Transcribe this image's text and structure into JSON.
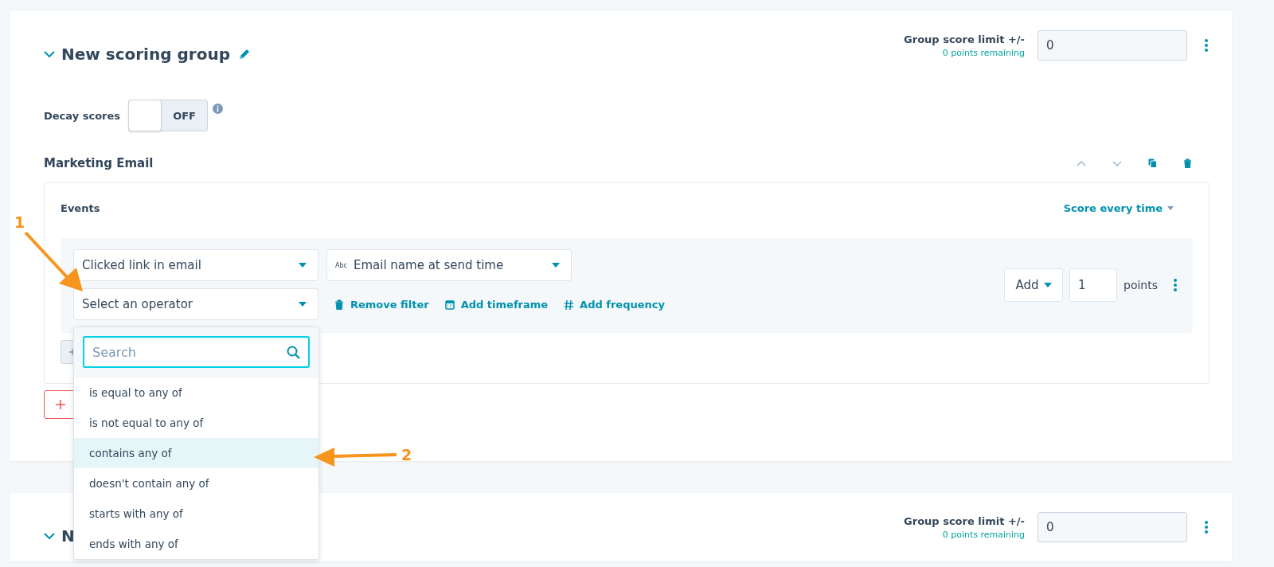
{
  "groups": [
    {
      "title": "New scoring group",
      "expanded": true,
      "score_limit_label": "Group score limit +/-",
      "remaining": "0 points remaining",
      "score_limit": "0",
      "decay": {
        "label": "Decay scores",
        "on": false,
        "state_text": "OFF"
      },
      "sections": [
        {
          "title": "Marketing Email",
          "events_label": "Events",
          "frequency": "Score every time",
          "filters": [
            {
              "event": "Clicked link in email",
              "property_badge": "Abc",
              "property": "Email name at send time",
              "operator_placeholder": "Select an operator",
              "actions": [
                {
                  "kind": "trash",
                  "label": "Remove filter"
                },
                {
                  "kind": "calendar",
                  "label": "Add timeframe"
                },
                {
                  "kind": "hash",
                  "label": "Add frequency"
                }
              ],
              "mode": "Add",
              "points": "1",
              "points_label": "points"
            }
          ]
        }
      ]
    },
    {
      "title": "N",
      "expanded": true,
      "score_limit_label": "Group score limit +/-",
      "remaining": "0 points remaining",
      "score_limit": "0"
    }
  ],
  "operator_dropdown": {
    "search_placeholder": "Search",
    "options": [
      {
        "label": "is equal to any of",
        "selected": false
      },
      {
        "label": "is not equal to any of",
        "selected": false
      },
      {
        "label": "contains any of",
        "selected": true
      },
      {
        "label": "doesn't contain any of",
        "selected": false
      },
      {
        "label": "starts with any of",
        "selected": false
      },
      {
        "label": "ends with any of",
        "selected": false
      }
    ]
  },
  "annotations": [
    {
      "label": "1"
    },
    {
      "label": "2"
    }
  ]
}
